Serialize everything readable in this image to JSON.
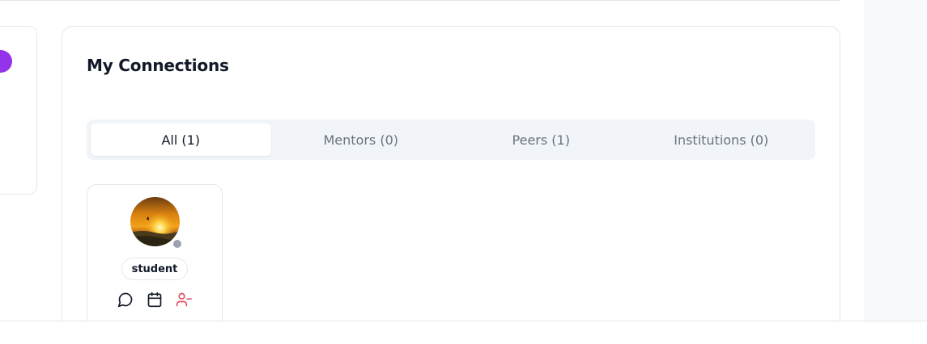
{
  "connections": {
    "title": "My Connections",
    "tabs": [
      {
        "label": "All (1)",
        "active": true
      },
      {
        "label": "Mentors (0)",
        "active": false
      },
      {
        "label": "Peers (1)",
        "active": false
      },
      {
        "label": "Institutions (0)",
        "active": false
      }
    ],
    "cards": [
      {
        "role": "student",
        "status": "offline",
        "actions": [
          "message-icon",
          "calendar-icon",
          "remove-user-icon"
        ]
      }
    ]
  },
  "colors": {
    "accent_purple": "#9333ea",
    "remove_red": "#e05261",
    "status_offline": "#9ca3af",
    "tab_bg": "#f1f4f8"
  }
}
